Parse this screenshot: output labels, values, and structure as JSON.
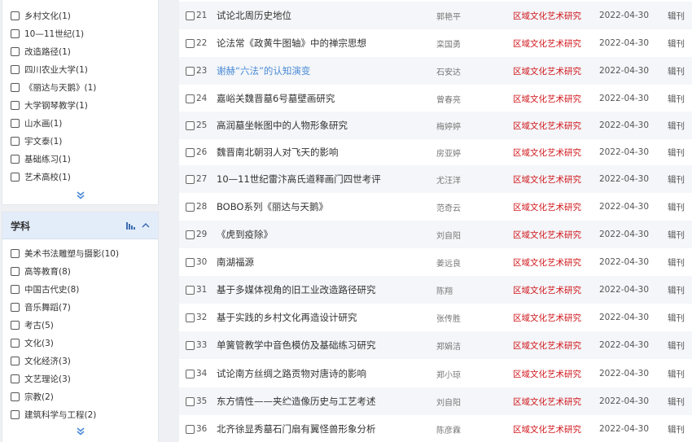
{
  "sidebar": {
    "top_items": [
      {
        "label": "乡村文化(1)"
      },
      {
        "label": "10—11世纪(1)"
      },
      {
        "label": "改造路径(1)"
      },
      {
        "label": "四川农业大学(1)"
      },
      {
        "label": "《丽达与天鹅》(1)"
      },
      {
        "label": "大学钢琴教学(1)"
      },
      {
        "label": "山水画(1)"
      },
      {
        "label": "宇文泰(1)"
      },
      {
        "label": "基础练习(1)"
      },
      {
        "label": "艺术高校(1)"
      }
    ],
    "expand_icon": "double-chevron-down",
    "subject_panel": {
      "title": "学科",
      "items": [
        {
          "label": "美术书法雕塑与摄影(10)"
        },
        {
          "label": "高等教育(8)"
        },
        {
          "label": "中国古代史(8)"
        },
        {
          "label": "音乐舞蹈(7)"
        },
        {
          "label": "考古(5)"
        },
        {
          "label": "文化(3)"
        },
        {
          "label": "文化经济(3)"
        },
        {
          "label": "文艺理论(3)"
        },
        {
          "label": "宗教(2)"
        },
        {
          "label": "建筑科学与工程(2)"
        }
      ]
    }
  },
  "results": [
    {
      "num": "21",
      "title": "试论北周历史地位",
      "author": "郭艳平",
      "source": "区域文化艺术研究",
      "date": "2022-04-30",
      "type": "辑刊"
    },
    {
      "num": "22",
      "title": "论法常《政黄牛图轴》中的禅宗思想",
      "author": "栾国勇",
      "source": "区域文化艺术研究",
      "date": "2022-04-30",
      "type": "辑刊"
    },
    {
      "num": "23",
      "title": "谢赫“六法”的认知演变",
      "author": "石安达",
      "source": "区域文化艺术研究",
      "date": "2022-04-30",
      "type": "辑刊",
      "highlight": true
    },
    {
      "num": "24",
      "title": "嘉峪关魏晋墓6号墓壁画研究",
      "author": "曾春亮",
      "source": "区域文化艺术研究",
      "date": "2022-04-30",
      "type": "辑刊"
    },
    {
      "num": "25",
      "title": "高润墓坐帐图中的人物形象研究",
      "author": "梅婷婷",
      "source": "区域文化艺术研究",
      "date": "2022-04-30",
      "type": "辑刊"
    },
    {
      "num": "26",
      "title": "魏晋南北朝羽人对飞天的影响",
      "author": "房亚婷",
      "source": "区域文化艺术研究",
      "date": "2022-04-30",
      "type": "辑刊"
    },
    {
      "num": "27",
      "title": "10—11世纪雷汴高氏道释画门四世考评",
      "author": "尤汪洋",
      "source": "区域文化艺术研究",
      "date": "2022-04-30",
      "type": "辑刊"
    },
    {
      "num": "28",
      "title": "BOBO系列《丽达与天鹅》",
      "author": "范奇云",
      "source": "区域文化艺术研究",
      "date": "2022-04-30",
      "type": "辑刊"
    },
    {
      "num": "29",
      "title": "《虎到疫除》",
      "author": "刘自阳",
      "source": "区域文化艺术研究",
      "date": "2022-04-30",
      "type": "辑刊"
    },
    {
      "num": "30",
      "title": "南湖福源",
      "author": "姜远良",
      "source": "区域文化艺术研究",
      "date": "2022-04-30",
      "type": "辑刊"
    },
    {
      "num": "31",
      "title": "基于多媒体视角的旧工业改造路径研究",
      "author": "陈翔",
      "source": "区域文化艺术研究",
      "date": "2022-04-30",
      "type": "辑刊"
    },
    {
      "num": "32",
      "title": "基于实践的乡村文化再造设计研究",
      "author": "张传胜",
      "source": "区域文化艺术研究",
      "date": "2022-04-30",
      "type": "辑刊"
    },
    {
      "num": "33",
      "title": "单簧管教学中音色模仿及基础练习研究",
      "author": "郑娟洁",
      "source": "区域文化艺术研究",
      "date": "2022-04-30",
      "type": "辑刊"
    },
    {
      "num": "34",
      "title": "试论南方丝绸之路贡物对唐诗的影响",
      "author": "郑小琼",
      "source": "区域文化艺术研究",
      "date": "2022-04-30",
      "type": "辑刊"
    },
    {
      "num": "35",
      "title": "东方情性——夹纻造像历史与工艺考述",
      "author": "刘自阳",
      "source": "区域文化艺术研究",
      "date": "2022-04-30",
      "type": "辑刊"
    },
    {
      "num": "36",
      "title": "北齐徐显秀墓石门扇有翼怪兽形象分析",
      "author": "陈彦霖",
      "source": "区域文化艺术研究",
      "date": "2022-04-30",
      "type": "辑刊"
    }
  ]
}
